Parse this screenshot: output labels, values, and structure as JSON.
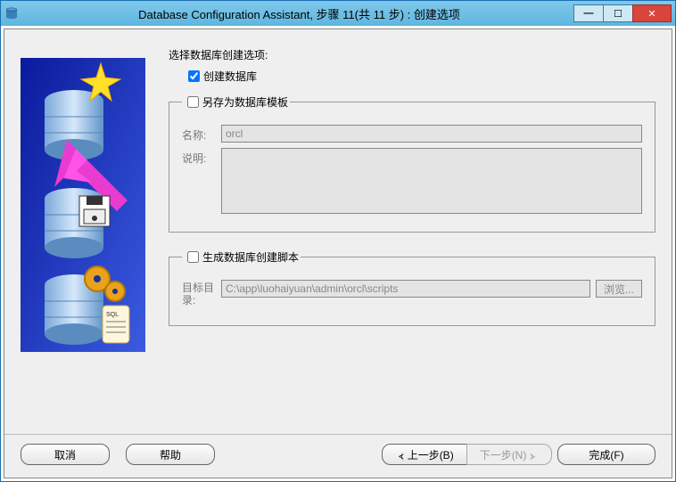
{
  "titlebar": {
    "title": "Database Configuration Assistant, 步骤 11(共 11 步) : 创建选项"
  },
  "main": {
    "select_label": "选择数据库创建选项:",
    "create_db": {
      "label": "创建数据库",
      "checked": true
    },
    "template_group": {
      "legend": "另存为数据库模板",
      "checked": false,
      "name_label": "名称:",
      "name_value": "orcl",
      "desc_label": "说明:",
      "desc_value": ""
    },
    "script_group": {
      "legend": "生成数据库创建脚本",
      "checked": false,
      "dest_label": "目标目录:",
      "dest_value": "C:\\app\\luohaiyuan\\admin\\orcl\\scripts",
      "browse_label": "浏览..."
    }
  },
  "buttons": {
    "cancel": "取消",
    "help": "帮助",
    "prev": "上一步(B)",
    "next": "下一步(N)",
    "finish": "完成(F)"
  }
}
